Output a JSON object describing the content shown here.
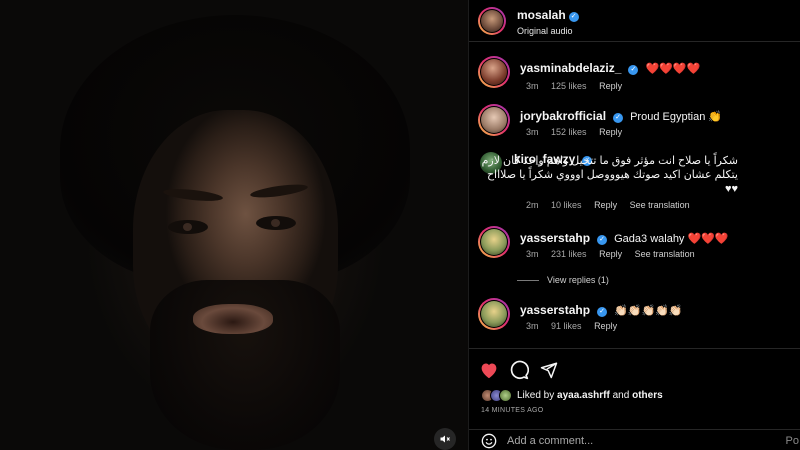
{
  "media": {
    "mute_icon": "speaker-muted-icon"
  },
  "header": {
    "username": "mosalah",
    "subtitle": "Original audio",
    "verified_mark": "✓"
  },
  "comments": [
    {
      "user": "yasminabdelaziz_",
      "text": "❤️❤️❤️❤️",
      "time": "3m",
      "likes": "125 likes",
      "reply": "Reply"
    },
    {
      "user": "jorybakrofficial",
      "text": "Proud Egyptian 👏",
      "time": "3m",
      "likes": "152 likes",
      "reply": "Reply"
    },
    {
      "user": "kiro_fawzy",
      "text": "شكراً يا صلاح انت مؤثر فوق ما تتخيل واهم واحد كان لازم يتكلم عشان اكيد صوتك هيوووصل اوووي شكراً يا صلاااح ♥♥",
      "time": "2m",
      "likes": "10 likes",
      "reply": "Reply",
      "translation": "See translation"
    },
    {
      "user": "yasserstahp",
      "text": "Gada3 walahy ❤️❤️❤️",
      "time": "3m",
      "likes": "231 likes",
      "reply": "Reply",
      "translation": "See translation"
    },
    {
      "user": "yasserstahp",
      "text": "👏🏻👏🏻👏🏻👏🏻👏🏻",
      "time": "3m",
      "likes": "91 likes",
      "reply": "Reply"
    }
  ],
  "view_replies": "View replies (1)",
  "liked_by": {
    "prefix": "Liked by",
    "user": "ayaa.ashrff",
    "joiner": "and",
    "others": "others"
  },
  "time_ago": "14 MINUTES AGO",
  "add_comment": {
    "placeholder": "Add a comment...",
    "post": "Po"
  },
  "colors": {
    "like_red": "#ed4956",
    "verified_blue": "#3897f0",
    "background": "#000000"
  }
}
